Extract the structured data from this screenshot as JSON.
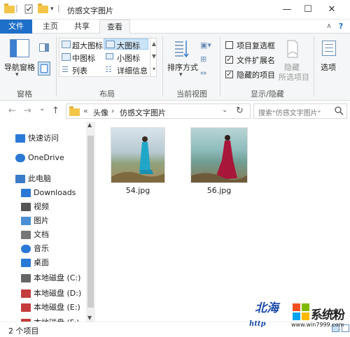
{
  "titlebar": {
    "title": "仿感文字图片",
    "minimize_glyph": "—",
    "maximize_glyph": "☐",
    "close_glyph": "✕"
  },
  "tabs": {
    "file": "文件",
    "home": "主页",
    "share": "共享",
    "view": "查看"
  },
  "ribbon": {
    "panes_group": {
      "nav_pane_label": "导航窗格",
      "group_label": "窗格"
    },
    "layout_group": {
      "items": [
        "超大图标",
        "大图标",
        "中图标",
        "小图标",
        "列表",
        "详细信息"
      ],
      "selected": "大图标",
      "group_label": "布局"
    },
    "current_view_group": {
      "sort_label": "排序方式",
      "group_label": "当前视图"
    },
    "show_hide_group": {
      "checkboxes": [
        {
          "label": "项目复选框",
          "checked": false
        },
        {
          "label": "文件扩展名",
          "checked": true
        },
        {
          "label": "隐藏的项目",
          "checked": true
        }
      ],
      "hide_selected_label_1": "隐藏",
      "hide_selected_label_2": "所选项目",
      "group_label": "显示/隐藏"
    },
    "options_label": "选项",
    "help_glyph": "?"
  },
  "address": {
    "back_glyph": "←",
    "forward_glyph": "→",
    "dropdown_glyph": "⌄",
    "up_glyph": "↑",
    "prefix": "«",
    "crumb1": "头像",
    "sep": "›",
    "crumb2": "仿感文字图片",
    "refresh_glyph": "↻",
    "search_placeholder": "搜索\"仿感文字图片\""
  },
  "nav": {
    "items": [
      {
        "label": "快速访问",
        "icon": "star-icon",
        "color": "#2b79d6"
      },
      {
        "label": "OneDrive",
        "icon": "cloud-icon",
        "color": "#2b79d6"
      },
      {
        "label": "此电脑",
        "icon": "computer-icon",
        "color": "#3a7bc8"
      },
      {
        "label": "Downloads",
        "icon": "download-icon",
        "color": "#2b79d6"
      },
      {
        "label": "视频",
        "icon": "video-icon",
        "color": "#555"
      },
      {
        "label": "图片",
        "icon": "picture-icon",
        "color": "#4a8fd4"
      },
      {
        "label": "文档",
        "icon": "document-icon",
        "color": "#777"
      },
      {
        "label": "音乐",
        "icon": "music-icon",
        "color": "#2b79d6"
      },
      {
        "label": "桌面",
        "icon": "desktop-icon",
        "color": "#2b79d6"
      },
      {
        "label": "本地磁盘 (C:)",
        "icon": "drive-icon",
        "color": "#666"
      },
      {
        "label": "本地磁盘 (D:)",
        "icon": "drive-icon",
        "color": "#c43c3c"
      },
      {
        "label": "本地磁盘 (E:)",
        "icon": "drive-icon",
        "color": "#c43c3c"
      },
      {
        "label": "本地磁盘 (F:)",
        "icon": "drive-icon",
        "color": "#c43c3c"
      }
    ]
  },
  "files": [
    {
      "name": "54.jpg"
    },
    {
      "name": "56.jpg"
    }
  ],
  "status": {
    "count": "2 个项目"
  },
  "watermark": {
    "site": "系统粉",
    "url": "www.win7999.com",
    "handwriting": "北海",
    "http": "http"
  }
}
